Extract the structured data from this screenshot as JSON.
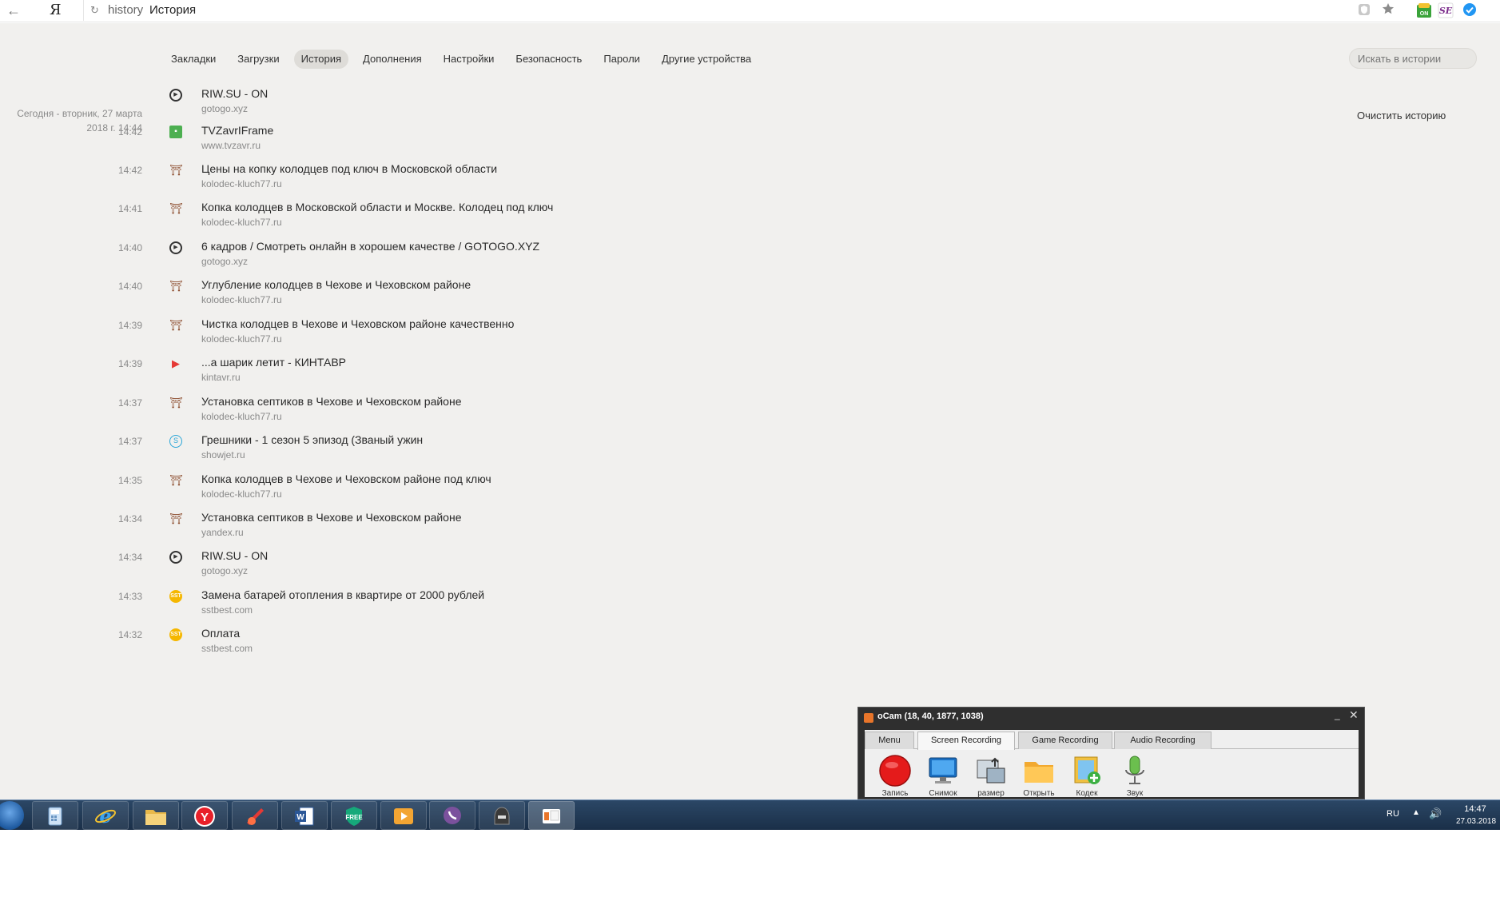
{
  "browser": {
    "logo": "Я",
    "back": "←",
    "reload": "↻",
    "url": "history",
    "tab_title": "История"
  },
  "nav": [
    "Закладки",
    "Загрузки",
    "История",
    "Дополнения",
    "Настройки",
    "Безопасность",
    "Пароли",
    "Другие устройства"
  ],
  "nav_active": "История",
  "search_placeholder": "Искать в истории",
  "clear_history": "Очистить историю",
  "date_label": "Сегодня - вторник, 27 марта 2018 г. 14:44",
  "history": [
    {
      "time": "",
      "icon": "play-circle-icon",
      "title": "RIW.SU - ON",
      "host": "gotogo.xyz"
    },
    {
      "time": "14:42",
      "icon": "tv-icon",
      "title": "TVZavrIFrame",
      "host": "www.tvzavr.ru"
    },
    {
      "time": "14:42",
      "icon": "well-icon",
      "title": "Цены на копку колодцев под ключ в Московской области",
      "host": "kolodec-kluch77.ru"
    },
    {
      "time": "14:41",
      "icon": "well-icon",
      "title": "Копка колодцев в Московской области и Москве. Колодец под ключ",
      "host": "kolodec-kluch77.ru"
    },
    {
      "time": "14:40",
      "icon": "play-circle-icon",
      "title": "6 кадров / Смотреть онлайн в хорошем качестве / GOTOGO.XYZ",
      "host": "gotogo.xyz"
    },
    {
      "time": "14:40",
      "icon": "well-icon",
      "title": "Углубление колодцев в Чехове и Чеховском районе",
      "host": "kolodec-kluch77.ru"
    },
    {
      "time": "14:39",
      "icon": "well-icon",
      "title": "Чистка колодцев в Чехове и Чеховском районе качественно",
      "host": "kolodec-kluch77.ru"
    },
    {
      "time": "14:39",
      "icon": "red-play-icon",
      "title": "...а шарик летит - КИНТАВР",
      "host": "kintavr.ru"
    },
    {
      "time": "14:37",
      "icon": "well-icon",
      "title": "Установка септиков в Чехове и Чеховском районе",
      "host": "kolodec-kluch77.ru"
    },
    {
      "time": "14:37",
      "icon": "showjet-icon",
      "title": "Грешники - 1 сезон 5 эпизод (Званый ужин",
      "host": "showjet.ru"
    },
    {
      "time": "14:35",
      "icon": "well-icon",
      "title": "Копка колодцев в Чехове и Чеховском районе под ключ",
      "host": "kolodec-kluch77.ru"
    },
    {
      "time": "14:34",
      "icon": "well-icon",
      "title": "Установка септиков в Чехове и Чеховском районе",
      "host": "yandex.ru"
    },
    {
      "time": "14:34",
      "icon": "play-circle-icon",
      "title": "RIW.SU - ON",
      "host": "gotogo.xyz"
    },
    {
      "time": "14:33",
      "icon": "sstbest-icon",
      "title": "Замена батарей отопления в квартире от 2000 рублей",
      "host": "sstbest.com"
    },
    {
      "time": "14:32",
      "icon": "sstbest-icon",
      "title": "Оплата",
      "host": "sstbest.com"
    }
  ],
  "ocam": {
    "title": "oCam (18, 40, 1877, 1038)",
    "tabs": [
      "Menu",
      "Screen Recording",
      "Game Recording",
      "Audio Recording"
    ],
    "active_tab": "Screen Recording",
    "tools": [
      "Запись",
      "Снимок",
      "размер",
      "Открыть",
      "Кодек",
      "Звук"
    ]
  },
  "tray": {
    "lang": "RU",
    "time": "14:47",
    "date": "27.03.2018"
  }
}
